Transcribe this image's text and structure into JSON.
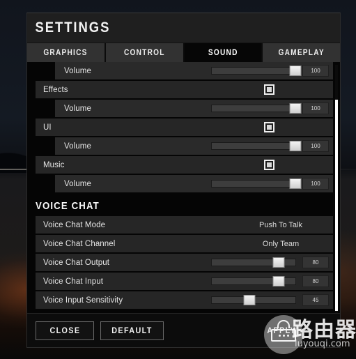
{
  "window": {
    "title": "SETTINGS"
  },
  "tabs": [
    {
      "label": "GRAPHICS",
      "active": false
    },
    {
      "label": "CONTROL",
      "active": false
    },
    {
      "label": "SOUND",
      "active": true
    },
    {
      "label": "GAMEPLAY",
      "active": false
    }
  ],
  "rows": [
    {
      "label": "Volume",
      "type": "slider",
      "indent": "child",
      "value": "100",
      "percent": 100
    },
    {
      "label": "Effects",
      "type": "checkbox",
      "indent": "parent",
      "checked": true
    },
    {
      "label": "Volume",
      "type": "slider",
      "indent": "child",
      "value": "100",
      "percent": 100
    },
    {
      "label": "UI",
      "type": "checkbox",
      "indent": "parent",
      "checked": true
    },
    {
      "label": "Volume",
      "type": "slider",
      "indent": "child",
      "value": "100",
      "percent": 100
    },
    {
      "label": "Music",
      "type": "checkbox",
      "indent": "parent",
      "checked": true
    },
    {
      "label": "Volume",
      "type": "slider",
      "indent": "child",
      "value": "100",
      "percent": 100
    }
  ],
  "voice_section": {
    "heading": "VOICE CHAT",
    "rows": [
      {
        "label": "Voice Chat Mode",
        "type": "value",
        "indent": "parent",
        "value": "Push To Talk"
      },
      {
        "label": "Voice Chat Channel",
        "type": "value",
        "indent": "parent",
        "value": "Only Team"
      },
      {
        "label": "Voice Chat Output",
        "type": "slider",
        "indent": "parent",
        "value": "80",
        "percent": 80
      },
      {
        "label": "Voice Chat Input",
        "type": "slider",
        "indent": "parent",
        "value": "80",
        "percent": 80
      },
      {
        "label": "Voice Input Sensitivity",
        "type": "slider",
        "indent": "parent",
        "value": "45",
        "percent": 45
      }
    ]
  },
  "footer": {
    "close_label": "CLOSE",
    "default_label": "DEFAULT",
    "apply_label": "APPLY"
  },
  "watermark": {
    "brand_cn": "路由器",
    "domain": "luyouqi.com",
    "icon": "router-icon"
  },
  "colors": {
    "panel_bg": "#0a0a0a",
    "titlebar_bg": "#1f1f1f",
    "tab_bg": "#323232",
    "tab_active_bg": "#060606",
    "row_bg": "#262626",
    "accent_white": "#ffffff"
  }
}
